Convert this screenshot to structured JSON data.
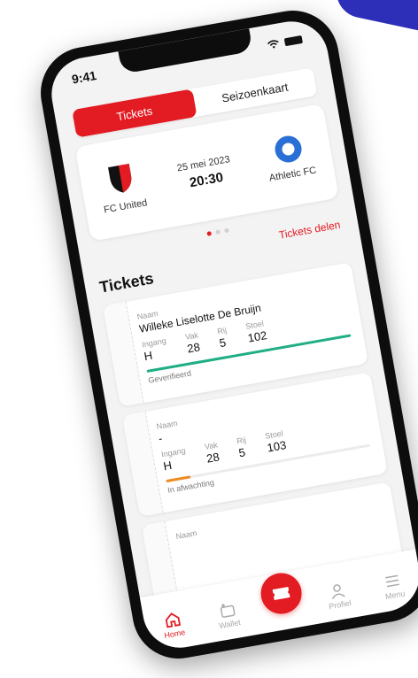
{
  "status": {
    "time": "9:41"
  },
  "segments": {
    "tickets": "Tickets",
    "season": "Seizoenkaart"
  },
  "match": {
    "home_team": "FC United",
    "away_team": "Athletic FC",
    "date": "25 mei 2023",
    "time": "20:30"
  },
  "share_label": "Tickets delen",
  "section_title": "Tickets",
  "labels": {
    "name": "Naam",
    "entrance": "Ingang",
    "section": "Vak",
    "row": "Rij",
    "seat": "Stoel"
  },
  "tickets": [
    {
      "name": "Willeke Liselotte De Bruijn",
      "entrance": "H",
      "section": "28",
      "row": "5",
      "seat": "102",
      "status": "Geverifieerd",
      "progress": 1.0,
      "color": "#1fae86"
    },
    {
      "name": "-",
      "entrance": "H",
      "section": "28",
      "row": "5",
      "seat": "103",
      "status": "In afwachting",
      "progress": 0.12,
      "color": "#f08a24"
    },
    {
      "name": "",
      "entrance": "",
      "section": "",
      "row": "",
      "seat": "",
      "status": "",
      "progress": 0,
      "color": "#cccccc"
    }
  ],
  "tabs": {
    "home": "Home",
    "wallet": "Wallet",
    "center": "",
    "profile": "Profiel",
    "menu": "Menu"
  },
  "colors": {
    "accent": "#e31b23",
    "away_team": "#2a6fd6"
  }
}
